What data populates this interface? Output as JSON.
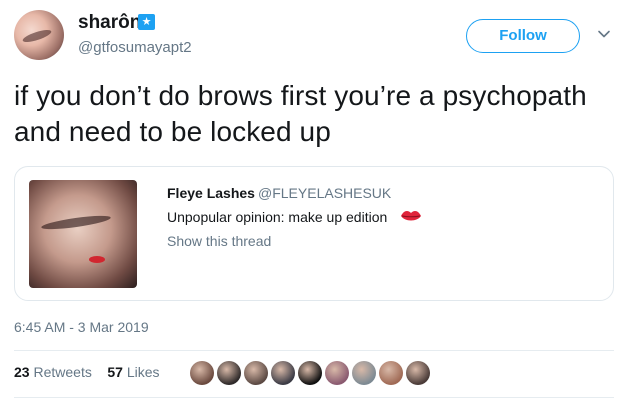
{
  "author": {
    "display_name": "sharôn",
    "handle": "@gtfosumayapt2",
    "verified_glyph": "★"
  },
  "follow_button": {
    "label": "Follow"
  },
  "tweet": {
    "text": "if you don’t do brows first you’re a psychopath and need to be locked up"
  },
  "quoted_tweet": {
    "name": "Fleye Lashes",
    "handle": "@FLEYELASHESUK",
    "text": "Unpopular opinion: make up edition",
    "emoji_icon": "lips-icon",
    "show_thread": "Show this thread"
  },
  "timestamp": "6:45 AM - 3 Mar 2019",
  "stats": {
    "retweets_count": "23",
    "retweets_label": "Retweets",
    "likes_count": "57",
    "likes_label": "Likes"
  },
  "likers": [
    {
      "color": "#6b4a3f"
    },
    {
      "color": "#2f2a2a"
    },
    {
      "color": "#5c4a44"
    },
    {
      "color": "#3b3b45"
    },
    {
      "color": "#111111"
    },
    {
      "color": "#8a5a70"
    },
    {
      "color": "#7d8a93"
    },
    {
      "color": "#a06a55"
    },
    {
      "color": "#4a3b38"
    }
  ],
  "colors": {
    "accent": "#1da1f2",
    "muted": "#657786",
    "text": "#14171a",
    "border": "#e1e8ed"
  }
}
